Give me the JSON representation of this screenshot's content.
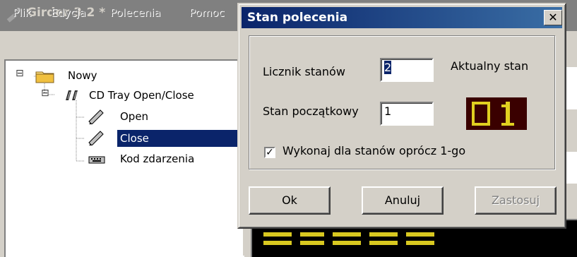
{
  "main_window": {
    "title": "Girder 3.2 *",
    "menu": {
      "file": "Plik",
      "edit": "Edycja",
      "commands": "Polecenia",
      "help": "Pomoc"
    },
    "tree": {
      "root": "Nowy",
      "group": "CD Tray Open/Close",
      "items": [
        "Open",
        "Close",
        "Kod zdarzenia"
      ],
      "expand_glyph": "⊟"
    }
  },
  "dialog": {
    "title": "Stan polecenia",
    "close_glyph": "✕",
    "state_counter_label": "Licznik stanów",
    "state_counter_value": "2",
    "initial_state_label": "Stan początkowy",
    "initial_state_value": "1",
    "current_state_label": "Aktualny stan",
    "current_state_display": "01",
    "checkbox_label": "Wykonaj dla stanów oprócz 1-go",
    "checkbox_checked": true,
    "checkbox_glyph": "✓",
    "buttons": {
      "ok": "Ok",
      "cancel": "Anuluj",
      "apply": "Zastosuj"
    }
  },
  "colors": {
    "led_on": "#e0d020",
    "led_bg": "#3a0000",
    "selection": "#0a246a"
  },
  "icons": {
    "app": "girder-icon",
    "folder": "folder-icon",
    "group": "multi-command-icon",
    "command": "pencil-icon",
    "event": "keyboard-icon"
  }
}
